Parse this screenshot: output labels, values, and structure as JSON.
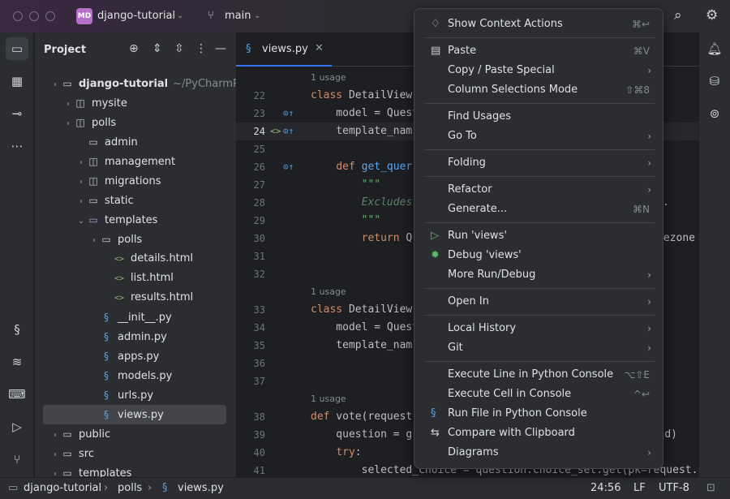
{
  "titlebar": {
    "project_badge": "MD",
    "project_name": "django-tutorial",
    "branch": "main",
    "icons": [
      "traffic-lights",
      "chevron-down-icon",
      "branch-icon",
      "search-icon",
      "gear-icon"
    ]
  },
  "left_toolbar": [
    "folder-icon",
    "structure-icon",
    "commit-icon",
    "more-icon",
    "python-icon",
    "layers-icon",
    "terminal-icon",
    "run-icon",
    "git-icon"
  ],
  "right_toolbar": [
    "bell-icon",
    "database-icon",
    "target-icon"
  ],
  "project_panel": {
    "title": "Project",
    "tree": [
      {
        "label": "django-tutorial",
        "hint": "~/PyCharmProj",
        "type": "folder",
        "chev": "›",
        "bold": true
      },
      {
        "label": "mysite",
        "type": "pkg",
        "chev": "›"
      },
      {
        "label": "polls",
        "type": "pkg",
        "chev": "›"
      },
      {
        "label": "admin",
        "type": "folder",
        "chev": ""
      },
      {
        "label": "management",
        "type": "pkg",
        "chev": "›"
      },
      {
        "label": "migrations",
        "type": "pkg",
        "chev": "›"
      },
      {
        "label": "static",
        "type": "folder",
        "chev": "›"
      },
      {
        "label": "templates",
        "type": "folder-open",
        "chev": "⌄"
      },
      {
        "label": "polls",
        "type": "folder",
        "chev": "›"
      },
      {
        "label": "details.html",
        "type": "html",
        "chev": ""
      },
      {
        "label": "list.html",
        "type": "html",
        "chev": ""
      },
      {
        "label": "results.html",
        "type": "html",
        "chev": ""
      },
      {
        "label": "__init__.py",
        "type": "py",
        "chev": ""
      },
      {
        "label": "admin.py",
        "type": "py",
        "chev": ""
      },
      {
        "label": "apps.py",
        "type": "py",
        "chev": ""
      },
      {
        "label": "models.py",
        "type": "py",
        "chev": ""
      },
      {
        "label": "urls.py",
        "type": "py",
        "chev": ""
      },
      {
        "label": "views.py",
        "type": "py",
        "chev": "",
        "selected": true
      },
      {
        "label": "public",
        "type": "folder",
        "chev": "›"
      },
      {
        "label": "src",
        "type": "folder",
        "chev": "›"
      },
      {
        "label": "templates",
        "type": "folder",
        "chev": "›"
      }
    ]
  },
  "editor": {
    "tab_label": "views.py",
    "usage_hint": "1 usage",
    "lines": [
      {
        "n": "22",
        "text": "class DetailView"
      },
      {
        "n": "23",
        "text": "    model = Quest"
      },
      {
        "n": "24",
        "text": "    template_nam"
      },
      {
        "n": "25",
        "text": ""
      },
      {
        "n": "26",
        "text": "    def get_quer"
      },
      {
        "n": "27",
        "text": "        \"\"\""
      },
      {
        "n": "28",
        "text": "        Excludes",
        "tail": "."
      },
      {
        "n": "29",
        "text": "        \"\"\""
      },
      {
        "n": "30",
        "text": "        return Q",
        "tail": "ezone"
      },
      {
        "n": "31",
        "text": ""
      },
      {
        "n": "32",
        "text": ""
      },
      {
        "n": "33",
        "text": "class DetailView"
      },
      {
        "n": "34",
        "text": "    model = Quest"
      },
      {
        "n": "35",
        "text": "    template_nam"
      },
      {
        "n": "36",
        "text": ""
      },
      {
        "n": "37",
        "text": ""
      },
      {
        "n": "38",
        "text": "def vote(request"
      },
      {
        "n": "39",
        "text": "    question = g",
        "tail": "d)"
      },
      {
        "n": "40",
        "text": "    try:"
      },
      {
        "n": "41",
        "text": "        selected_choice = question.choice_set.get(pk=request."
      }
    ]
  },
  "context_menu": {
    "items": [
      {
        "icon": "lightbulb-icon",
        "label": "Show Context Actions",
        "shortcut": "⌘↩"
      },
      {
        "sep": true
      },
      {
        "icon": "clipboard-icon",
        "label": "Paste",
        "shortcut": "⌘V"
      },
      {
        "label": "Copy / Paste Special",
        "submenu": true
      },
      {
        "label": "Column Selections Mode",
        "shortcut": "⇧⌘8"
      },
      {
        "sep": true
      },
      {
        "label": "Find Usages"
      },
      {
        "label": "Go To",
        "submenu": true
      },
      {
        "sep": true
      },
      {
        "label": "Folding",
        "submenu": true
      },
      {
        "sep": true
      },
      {
        "label": "Refactor",
        "submenu": true
      },
      {
        "label": "Generate...",
        "shortcut": "⌘N"
      },
      {
        "sep": true
      },
      {
        "icon": "run-icon",
        "label": "Run 'views'"
      },
      {
        "icon": "debug-icon",
        "label": "Debug 'views'"
      },
      {
        "label": "More Run/Debug",
        "submenu": true
      },
      {
        "sep": true
      },
      {
        "label": "Open In",
        "submenu": true
      },
      {
        "sep": true
      },
      {
        "label": "Local History",
        "submenu": true
      },
      {
        "label": "Git",
        "submenu": true
      },
      {
        "sep": true
      },
      {
        "label": "Execute Line in Python Console",
        "shortcut": "⌥⇧E"
      },
      {
        "label": "Execute Cell in Console",
        "shortcut": "^↩"
      },
      {
        "icon": "python-icon",
        "label": "Run File in Python Console"
      },
      {
        "icon": "compare-icon",
        "label": "Compare with Clipboard"
      },
      {
        "label": "Diagrams",
        "submenu": true
      }
    ]
  },
  "statusbar": {
    "breadcrumb": [
      "django-tutorial",
      "polls",
      "views.py"
    ],
    "position": "24:56",
    "line_ending": "LF",
    "encoding": "UTF-8"
  }
}
